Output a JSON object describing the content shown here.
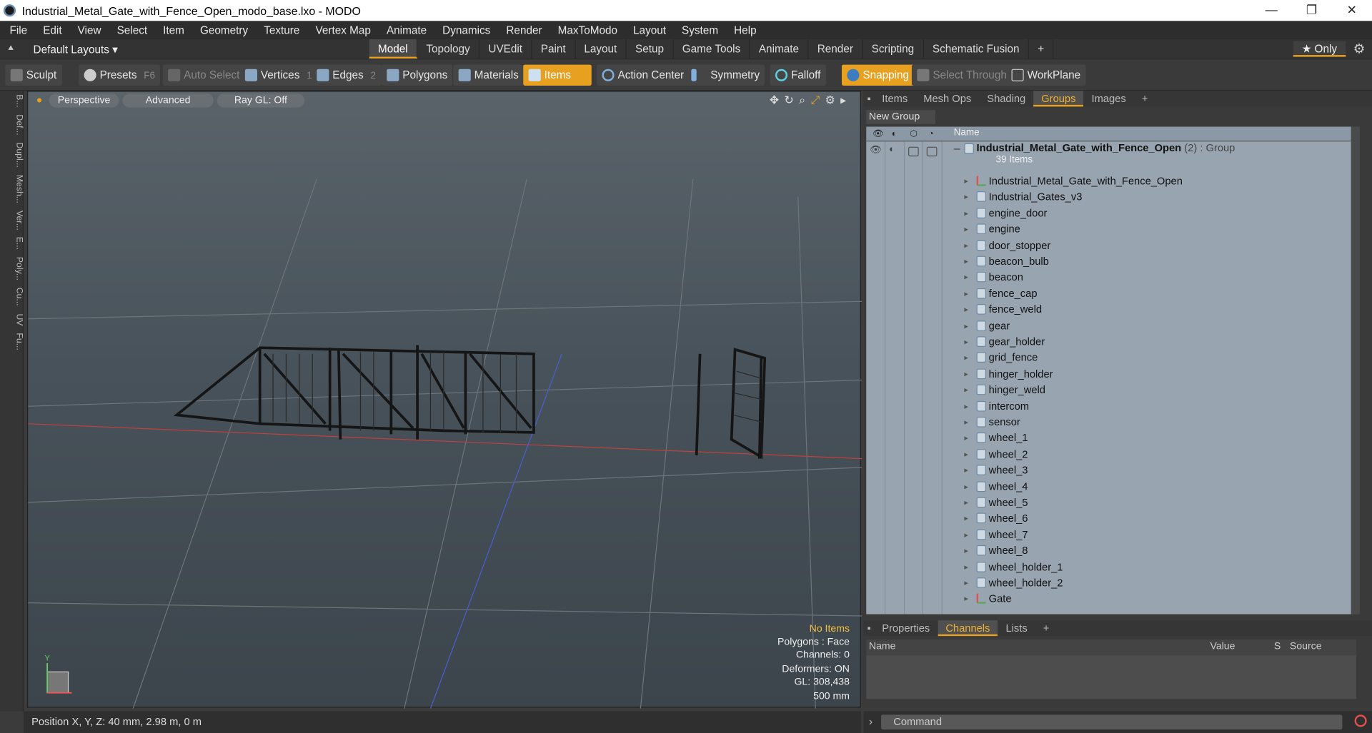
{
  "window": {
    "title": "Industrial_Metal_Gate_with_Fence_Open_modo_base.lxo - MODO",
    "minimize": "—",
    "restore": "❐",
    "close": "✕"
  },
  "menu": [
    "File",
    "Edit",
    "View",
    "Select",
    "Item",
    "Geometry",
    "Texture",
    "Vertex Map",
    "Animate",
    "Dynamics",
    "Render",
    "MaxToModo",
    "Layout",
    "System",
    "Help"
  ],
  "layouts": {
    "default_label": "Default Layouts ▾",
    "only_label": "★ Only",
    "tabs": [
      "Model",
      "Topology",
      "UVEdit",
      "Paint",
      "Layout",
      "Setup",
      "Game Tools",
      "Animate",
      "Render",
      "Scripting",
      "Schematic Fusion",
      "+"
    ],
    "active_tab": "Model"
  },
  "toolbar": {
    "sculpt": "Sculpt",
    "presets": "Presets",
    "presets_key": "F6",
    "auto_select": "Auto Select",
    "vertices": "Vertices",
    "vertices_num": "1",
    "edges": "Edges",
    "edges_num": "2",
    "polygons": "Polygons",
    "materials": "Materials",
    "items": "Items",
    "action_center": "Action Center",
    "symmetry": "Symmetry",
    "falloff": "Falloff",
    "snapping": "Snapping",
    "select_through": "Select Through",
    "workplane": "WorkPlane"
  },
  "left_strip": [
    "B...",
    "Def...",
    "Dupl...",
    "Mesh...",
    "Ver...",
    "E...",
    "Poly...",
    "Cu...",
    "UV",
    "Fu..."
  ],
  "viewport": {
    "perspective": "Perspective",
    "advanced": "Advanced",
    "raygl": "Ray GL: Off",
    "stats": {
      "no_items": "No Items",
      "polygons": "Polygons : Face",
      "channels": "Channels: 0",
      "deformers": "Deformers: ON",
      "gl": "GL: 308,438",
      "scale": "500 mm"
    }
  },
  "panel": {
    "tabs": [
      "Items",
      "Mesh Ops",
      "Shading",
      "Groups",
      "Images",
      "+"
    ],
    "active_tab": "Groups",
    "new_group": "New Group",
    "name_col": "Name",
    "group": {
      "name": "Industrial_Metal_Gate_with_Fence_Open",
      "count": "(2)",
      "type": ": Group",
      "items_label": "39 Items"
    },
    "items": [
      "Industrial_Metal_Gate_with_Fence_Open",
      "Industrial_Gates_v3",
      "engine_door",
      "engine",
      "door_stopper",
      "beacon_bulb",
      "beacon",
      "fence_cap",
      "fence_weld",
      "gear",
      "gear_holder",
      "grid_fence",
      "hinger_holder",
      "hinger_weld",
      "intercom",
      "sensor",
      "wheel_1",
      "wheel_2",
      "wheel_3",
      "wheel_4",
      "wheel_5",
      "wheel_6",
      "wheel_7",
      "wheel_8",
      "wheel_holder_1",
      "wheel_holder_2",
      "Gate"
    ]
  },
  "channels": {
    "tabs": [
      "Properties",
      "Channels",
      "Lists",
      "+"
    ],
    "active_tab": "Channels",
    "cols": {
      "name": "Name",
      "value": "Value",
      "s": "S",
      "source": "Source"
    }
  },
  "status": {
    "position": "Position X, Y, Z:   40 mm, 2.98 m, 0 m",
    "command_placeholder": "Command"
  },
  "colors": {
    "accent": "#e8a020",
    "viewport_top": "#5a636a",
    "tree_bg": "#98a4b0"
  }
}
